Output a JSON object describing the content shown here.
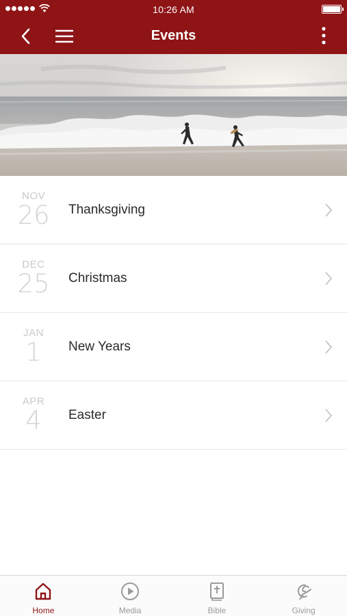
{
  "status_bar": {
    "time": "10:26 AM"
  },
  "nav": {
    "title": "Events"
  },
  "events": [
    {
      "month": "NOV",
      "day": "26",
      "name": "Thanksgiving"
    },
    {
      "month": "DEC",
      "day": "25",
      "name": "Christmas"
    },
    {
      "month": "JAN",
      "day": "1",
      "name": "New Years"
    },
    {
      "month": "APR",
      "day": "4",
      "name": "Easter"
    }
  ],
  "tabs": [
    {
      "label": "Home",
      "icon": "home-icon",
      "active": true
    },
    {
      "label": "Media",
      "icon": "play-circle-icon",
      "active": false
    },
    {
      "label": "Bible",
      "icon": "bible-icon",
      "active": false
    },
    {
      "label": "Giving",
      "icon": "giving-icon",
      "active": false
    }
  ],
  "colors": {
    "brand": "#8f1416",
    "inactive_tab": "#9a9a9a",
    "date_text": "#c9c9c9"
  }
}
